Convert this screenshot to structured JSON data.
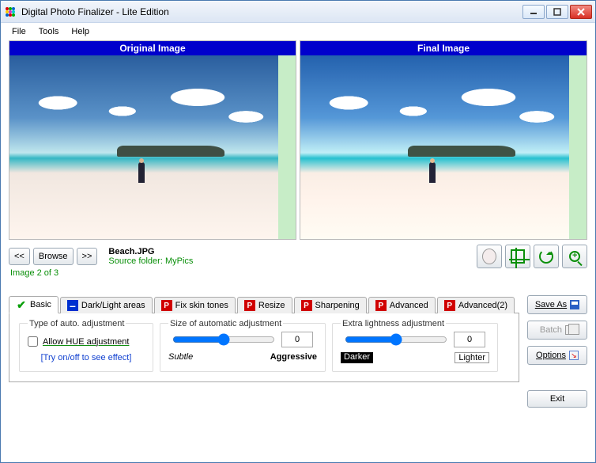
{
  "window": {
    "title": "Digital Photo Finalizer - Lite Edition"
  },
  "menu": {
    "file": "File",
    "tools": "Tools",
    "help": "Help"
  },
  "panels": {
    "original": "Original Image",
    "final": "Final Image"
  },
  "nav": {
    "prev": "<<",
    "browse": "Browse",
    "next": ">>",
    "filename": "Beach.JPG",
    "folder": "Source folder: MyPics",
    "counter": "Image 2 of 3"
  },
  "tabs": {
    "basic": "Basic",
    "darklight": "Dark/Light areas",
    "skin": "Fix skin tones",
    "resize": "Resize",
    "sharpen": "Sharpening",
    "advanced": "Advanced",
    "advanced2": "Advanced(2)"
  },
  "basic": {
    "auto_type_title": "Type of auto. adjustment",
    "allow_hue": "Allow HUE adjustment",
    "hint": "[Try on/off to see effect]",
    "size_title": "Size of automatic adjustment",
    "size_value": "0",
    "size_left": "Subtle",
    "size_right": "Aggressive",
    "extra_title": "Extra lightness adjustment",
    "extra_value": "0",
    "extra_left": "Darker",
    "extra_right": "Lighter"
  },
  "side": {
    "save_as": "Save As",
    "batch": "Batch",
    "options": "Options",
    "exit": "Exit"
  }
}
